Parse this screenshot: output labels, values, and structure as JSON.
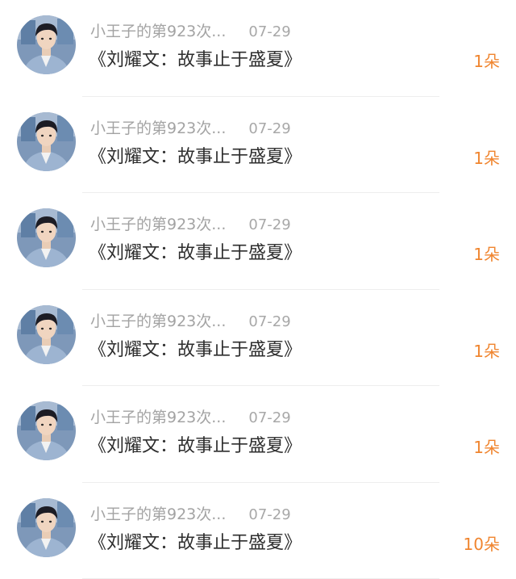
{
  "feed": {
    "items": [
      {
        "user": "小王子的第923次...",
        "date": "07-29",
        "title": "《刘耀文：故事止于盛夏》",
        "amount": "1朵"
      },
      {
        "user": "小王子的第923次...",
        "date": "07-29",
        "title": "《刘耀文：故事止于盛夏》",
        "amount": "1朵"
      },
      {
        "user": "小王子的第923次...",
        "date": "07-29",
        "title": "《刘耀文：故事止于盛夏》",
        "amount": "1朵"
      },
      {
        "user": "小王子的第923次...",
        "date": "07-29",
        "title": "《刘耀文：故事止于盛夏》",
        "amount": "1朵"
      },
      {
        "user": "小王子的第923次...",
        "date": "07-29",
        "title": "《刘耀文：故事止于盛夏》",
        "amount": "1朵"
      },
      {
        "user": "小王子的第923次...",
        "date": "07-29",
        "title": "《刘耀文：故事止于盛夏》",
        "amount": "10朵"
      }
    ]
  },
  "colors": {
    "amount": "#f0852f",
    "meta_text": "#a3a3a3",
    "title_text": "#2d2d2d",
    "divider": "#eeeeee"
  },
  "icons": {
    "avatar": "user-avatar-photo"
  }
}
